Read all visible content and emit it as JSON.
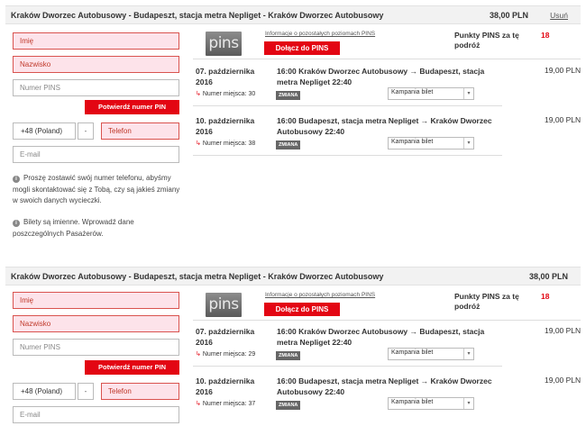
{
  "bookings": [
    {
      "route_title": "Kraków Dworzec Autobusowy - Budapeszt, stacja metra Nepliget - Kraków Dworzec Autobusowy",
      "total_price": "38,00 PLN",
      "remove_label": "Usuń",
      "form": {
        "first_name_placeholder": "Imię",
        "last_name_placeholder": "Nazwisko",
        "pins_number_placeholder": "Numer PINS",
        "confirm_pin_label": "Potwierdź numer PIN",
        "country_code": "+48 (Poland)",
        "country_arrow": "-",
        "phone_placeholder": "Telefon",
        "email_placeholder": "E-mail"
      },
      "info": {
        "phone_note": "Proszę zostawić swój numer telefonu, abyśmy mogli skontaktować się z Tobą, czy są jakieś zmiany w swoich danych wycieczki.",
        "tickets_note": "Bilety są imienne. Wprowadź dane poszczególnych Pasażerów."
      },
      "pins": {
        "logo_text": "pins",
        "info_link": "Informacje o pozostałych poziomach PINS",
        "join_label": "Dołącz do PINS",
        "points_label": "Punkty PINS za tę podróż",
        "points_value": "18"
      },
      "trips": [
        {
          "date": "07. października 2016",
          "desc": "16:00 Kraków Dworzec Autobusowy → Budapeszt, stacja metra Nepliget 22:40",
          "price": "19,00 PLN",
          "seat": "Numer miejsca: 30",
          "change": "ZMIANA",
          "campaign": "Kampania bilet"
        },
        {
          "date": "10. października 2016",
          "desc": "16:00 Budapeszt, stacja metra Nepliget → Kraków Dworzec Autobusowy 22:40",
          "price": "19,00 PLN",
          "seat": "Numer miejsca: 38",
          "change": "ZMIANA",
          "campaign": "Kampania bilet"
        }
      ]
    },
    {
      "route_title": "Kraków Dworzec Autobusowy - Budapeszt, stacja metra Nepliget - Kraków Dworzec Autobusowy",
      "total_price": "38,00 PLN",
      "form": {
        "first_name_placeholder": "Imię",
        "last_name_placeholder": "Nazwisko",
        "pins_number_placeholder": "Numer PINS",
        "confirm_pin_label": "Potwierdź numer PIN",
        "country_code": "+48 (Poland)",
        "country_arrow": "-",
        "phone_placeholder": "Telefon",
        "email_placeholder": "E-mail"
      },
      "pins": {
        "logo_text": "pins",
        "info_link": "Informacje o pozostałych poziomach PINS",
        "join_label": "Dołącz do PINS",
        "points_label": "Punkty PINS za tę podróż",
        "points_value": "18"
      },
      "trips": [
        {
          "date": "07. października 2016",
          "desc": "16:00 Kraków Dworzec Autobusowy → Budapeszt, stacja metra Nepliget 22:40",
          "price": "19,00 PLN",
          "seat": "Numer miejsca: 29",
          "change": "ZMIANA",
          "campaign": "Kampania bilet"
        },
        {
          "date": "10. października 2016",
          "desc": "16:00 Budapeszt, stacja metra Nepliget → Kraków Dworzec Autobusowy 22:40",
          "price": "19,00 PLN",
          "seat": "Numer miejsca: 37",
          "change": "ZMIANA",
          "campaign": "Kampania bilet"
        }
      ]
    }
  ]
}
